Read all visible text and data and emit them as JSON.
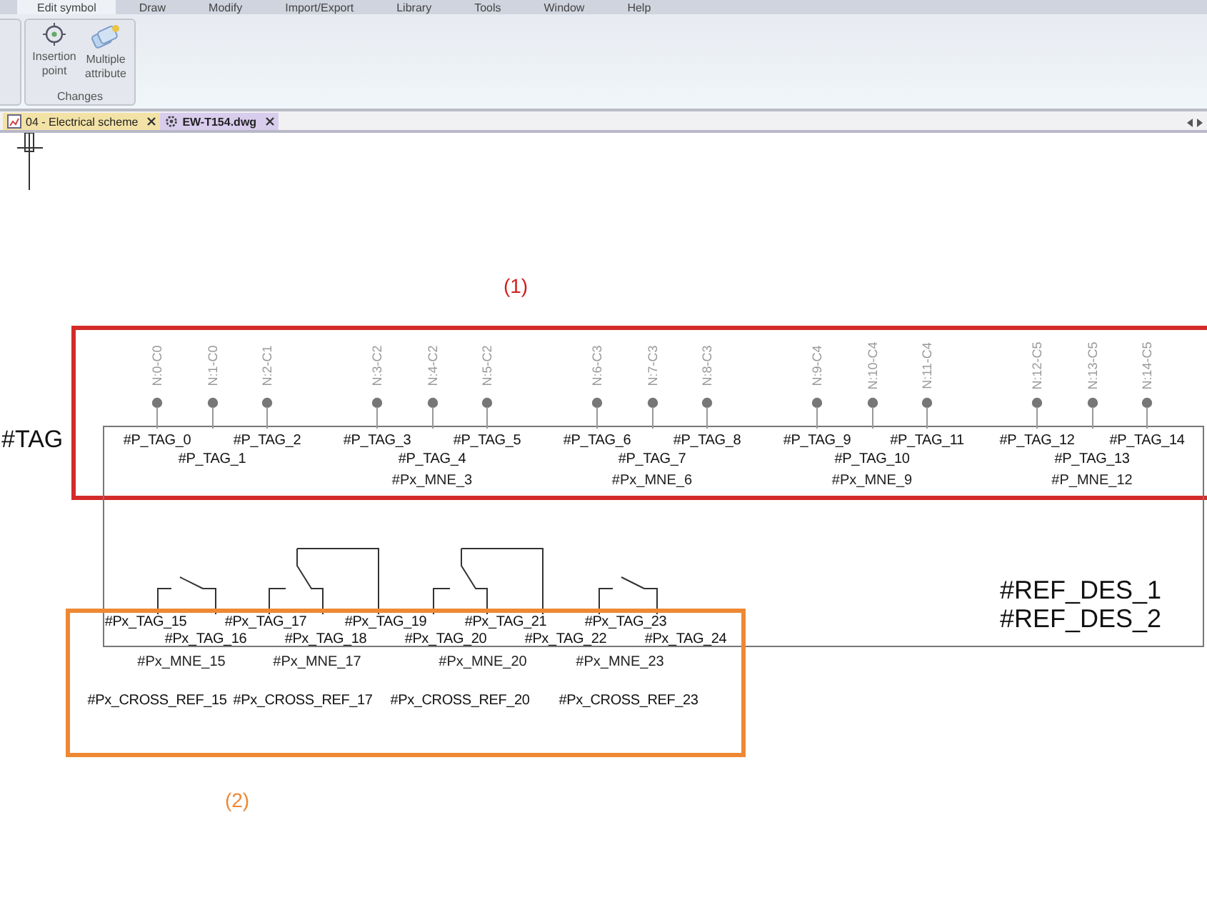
{
  "menu": [
    {
      "label": "Edit symbol",
      "selected": true
    },
    {
      "label": "Draw",
      "selected": false
    },
    {
      "label": "Modify",
      "selected": false
    },
    {
      "label": "Import/Export",
      "selected": false
    },
    {
      "label": "Library",
      "selected": false
    },
    {
      "label": "Tools",
      "selected": false
    },
    {
      "label": "Window",
      "selected": false
    },
    {
      "label": "Help",
      "selected": false
    }
  ],
  "ribbon": {
    "group": "Changes",
    "buttons": [
      {
        "kind": "insertion",
        "label": "Insertion point"
      },
      {
        "kind": "multiple",
        "label": "Multiple attribute"
      }
    ]
  },
  "documents": [
    {
      "title": "04 - Electrical scheme",
      "kind": "scheme",
      "selected": false
    },
    {
      "title": "EW-T154.dwg",
      "kind": "dwg",
      "selected": true
    }
  ],
  "drawing": {
    "callout_1": "(1)",
    "callout_2": "(2)",
    "tag": "#TAG",
    "ref_des": [
      "#REF_DES_1",
      "#REF_DES_2"
    ],
    "groups": [
      {
        "pins": [
          {
            "label": "N:0-C0",
            "tag": "#P_TAG_0"
          },
          {
            "label": "N:1-C0",
            "tag": "#P_TAG_1"
          },
          {
            "label": "N:2-C1",
            "tag": "#P_TAG_2"
          }
        ]
      },
      {
        "mne": "#Px_MNE_3",
        "pins": [
          {
            "label": "N:3-C2",
            "tag": "#P_TAG_3"
          },
          {
            "label": "N:4-C2",
            "tag": "#P_TAG_4"
          },
          {
            "label": "N:5-C2",
            "tag": "#P_TAG_5"
          }
        ]
      },
      {
        "mne": "#Px_MNE_6",
        "pins": [
          {
            "label": "N:6-C3",
            "tag": "#P_TAG_6"
          },
          {
            "label": "N:7-C3",
            "tag": "#P_TAG_7"
          },
          {
            "label": "N:8-C3",
            "tag": "#P_TAG_8"
          }
        ]
      },
      {
        "mne": "#Px_MNE_9",
        "pins": [
          {
            "label": "N:9-C4",
            "tag": "#P_TAG_9"
          },
          {
            "label": "N:10-C4",
            "tag": "#P_TAG_10"
          },
          {
            "label": "N:11-C4",
            "tag": "#P_TAG_11"
          }
        ]
      },
      {
        "mne": "#P_MNE_12",
        "pins": [
          {
            "label": "N:12-C5",
            "tag": "#P_TAG_12"
          },
          {
            "label": "N:13-C5",
            "tag": "#P_TAG_13"
          },
          {
            "label": "N:14-C5",
            "tag": "#P_TAG_14"
          }
        ]
      }
    ],
    "contact_tags": [
      "#Px_TAG_15",
      "#Px_TAG_16",
      "#Px_TAG_17",
      "#Px_TAG_18",
      "#Px_TAG_19",
      "#Px_TAG_20",
      "#Px_TAG_21",
      "#Px_TAG_22",
      "#Px_TAG_23",
      "#Px_TAG_24"
    ],
    "contacts": [
      {
        "kind": "short",
        "mne": "#Px_MNE_15",
        "cross_ref": "#Px_CROSS_REF_15"
      },
      {
        "kind": "tall",
        "mne": "#Px_MNE_17",
        "cross_ref": "#Px_CROSS_REF_17"
      },
      {
        "kind": "tall",
        "mne": "#Px_MNE_20",
        "cross_ref": "#Px_CROSS_REF_20"
      },
      {
        "kind": "short",
        "mne": "#Px_MNE_23",
        "cross_ref": "#Px_CROSS_REF_23"
      }
    ]
  }
}
